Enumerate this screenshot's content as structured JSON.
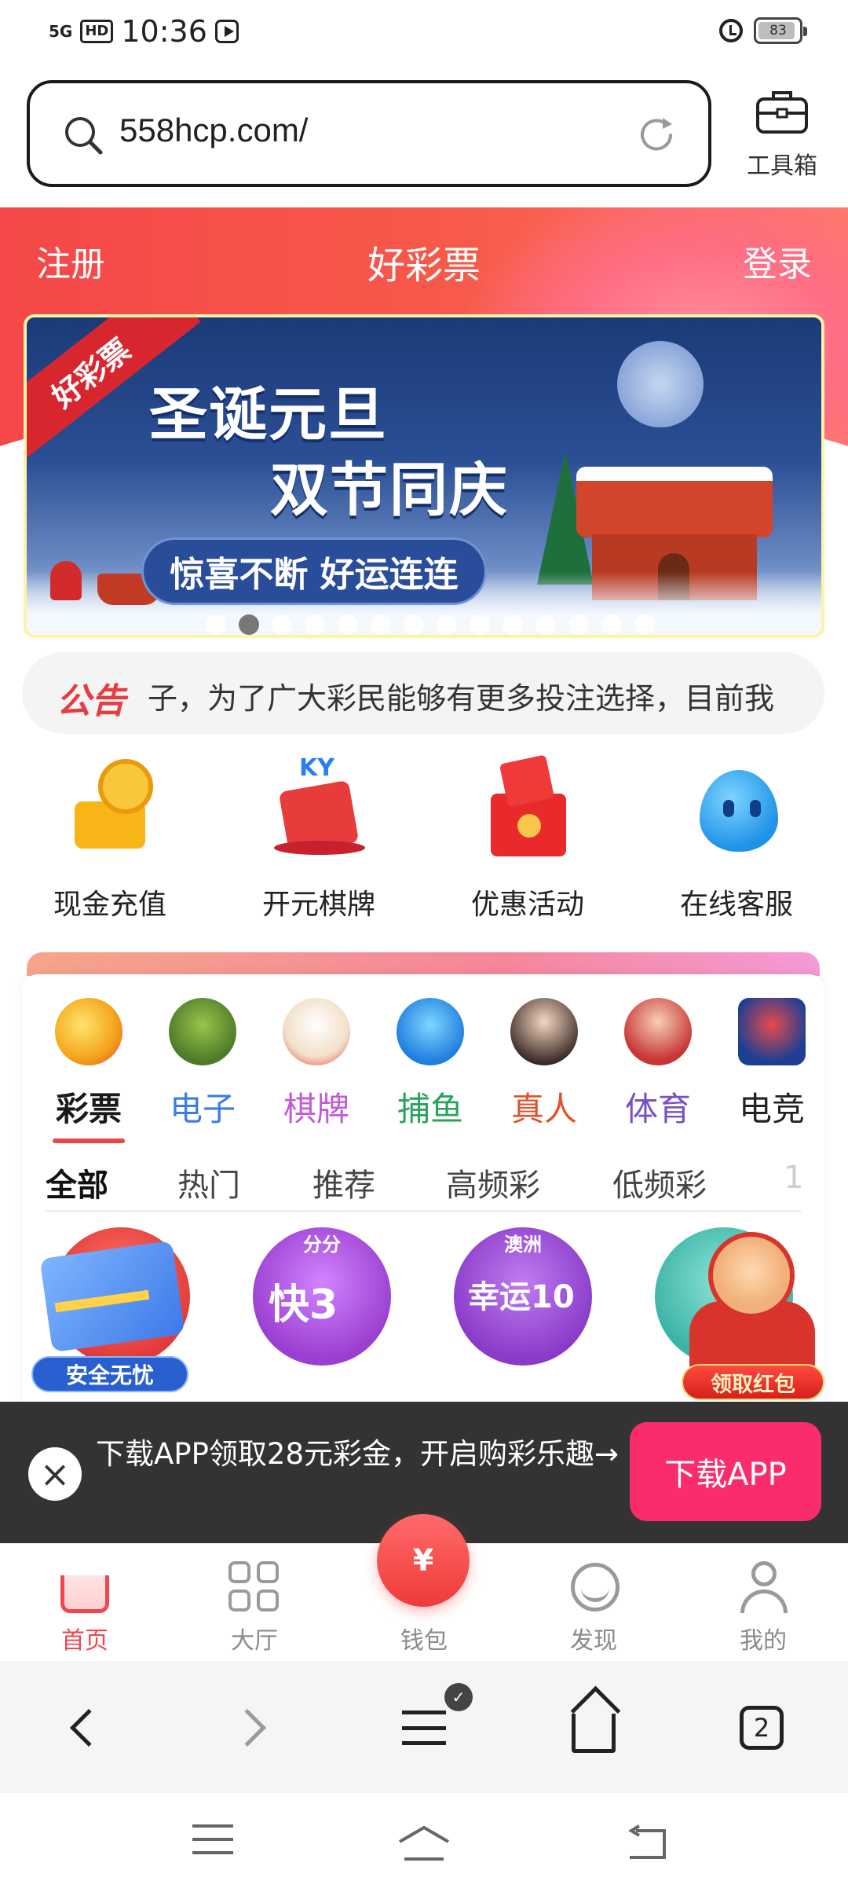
{
  "status_bar": {
    "network": "5G",
    "hd": "HD",
    "time": "10:36",
    "battery": "83"
  },
  "url_bar": {
    "url": "558hcp.com/"
  },
  "toolbox": {
    "label": "工具箱"
  },
  "header": {
    "register": "注册",
    "title": "好彩票",
    "login": "登录"
  },
  "banner": {
    "ribbon": "好彩票",
    "line1": "圣诞元旦",
    "line2": "双节同庆",
    "pill": "惊喜不断 好运连连",
    "slide_count": 14,
    "active_slide": 1
  },
  "notice": {
    "label": "公告",
    "text": "子，为了广大彩民能够有更多投注选择，目前我"
  },
  "quick_actions": [
    {
      "label": "现金充值",
      "icon": "cash-recharge-icon"
    },
    {
      "label": "开元棋牌",
      "icon": "ky-poker-icon"
    },
    {
      "label": "优惠活动",
      "icon": "gift-icon"
    },
    {
      "label": "在线客服",
      "icon": "customer-service-icon"
    }
  ],
  "categories": [
    {
      "label": "彩票",
      "color": "#1a1a1a",
      "active": true
    },
    {
      "label": "电子",
      "color": "#3c7de0"
    },
    {
      "label": "棋牌",
      "color": "#c35ad6"
    },
    {
      "label": "捕鱼",
      "color": "#2aa35a"
    },
    {
      "label": "真人",
      "color": "#e2522a"
    },
    {
      "label": "体育",
      "color": "#7a4fc8"
    },
    {
      "label": "电竞",
      "color": "#222222"
    }
  ],
  "sub_tabs": [
    "全部",
    "热门",
    "推荐",
    "高频彩",
    "低频彩",
    "1"
  ],
  "games": [
    {
      "tag": "",
      "name": "",
      "color": "#e23a3a"
    },
    {
      "tag": "分分",
      "name": "快3",
      "color": "#9b3fd1"
    },
    {
      "tag": "澳洲",
      "name": "幸运10",
      "color": "#8a3cc9"
    },
    {
      "tag": "",
      "name": "",
      "color": "#3bb4a5"
    }
  ],
  "float_card": {
    "badge": "安全无忧"
  },
  "float_red": {
    "badge": "领取红包"
  },
  "download_bar": {
    "text": "下载APP领取28元彩金，开启购彩乐趣→",
    "button": "下载APP"
  },
  "app_nav": {
    "items": [
      {
        "label": "首页",
        "active": true
      },
      {
        "label": "大厅"
      },
      {
        "label": "钱包"
      },
      {
        "label": "发现"
      },
      {
        "label": "我的"
      }
    ],
    "wallet_symbol": "¥"
  },
  "browser_bar": {
    "tab_count": "2"
  },
  "colors": {
    "brand_red": "#f54749",
    "download_pink": "#fb2c6b",
    "dark_bar": "#333333"
  }
}
